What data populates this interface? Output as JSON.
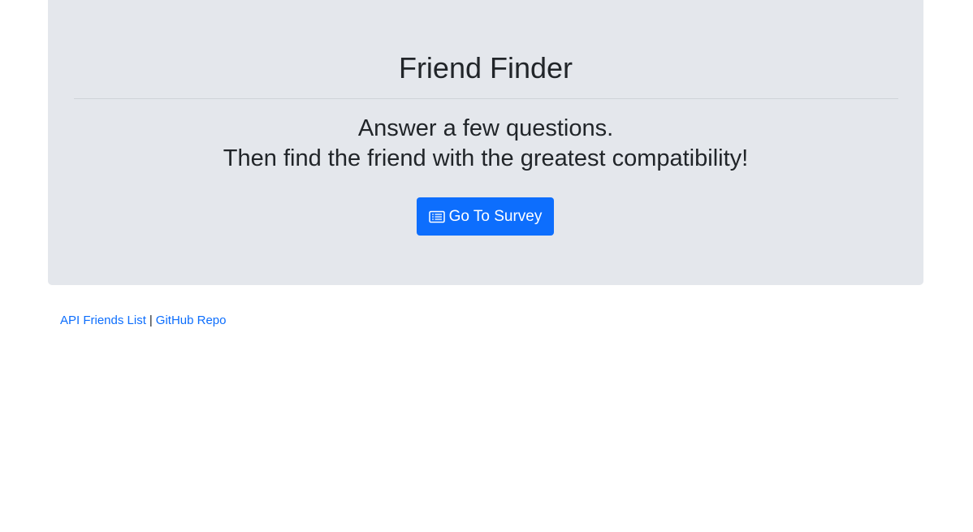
{
  "hero": {
    "title": "Friend Finder",
    "lead_line1": "Answer a few questions.",
    "lead_line2": "Then find the friend with the greatest compatibility!",
    "survey_button": {
      "label": "Go To Survey",
      "icon": "card-list-icon"
    }
  },
  "footer": {
    "api_link": "API Friends List",
    "separator": "|",
    "github_link": "GitHub Repo"
  },
  "colors": {
    "jumbotron_bg": "#e4e7ec",
    "primary": "#0d6efd",
    "text": "#212529"
  }
}
